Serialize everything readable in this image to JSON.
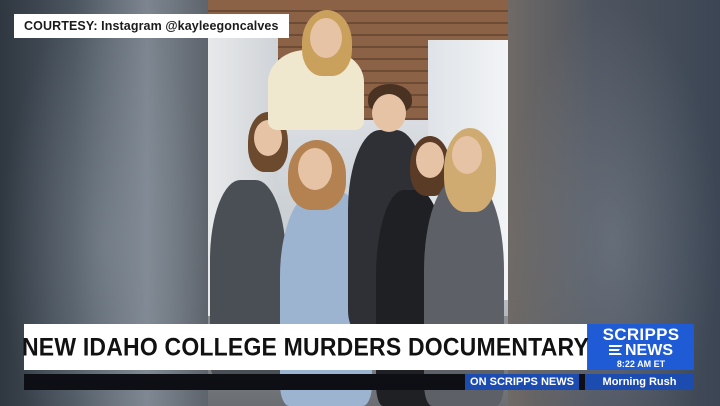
{
  "courtesy": {
    "text": "COURTESY: Instagram @kayleegoncalves"
  },
  "lower_third": {
    "headline": "NEW IDAHO COLLEGE MURDERS DOCUMENTARY",
    "logo_line1": "SCRIPPS",
    "logo_line2": "NEWS",
    "time": "8:22 AM ET",
    "ticker_source": "ON SCRIPPS NEWS",
    "show_name": "Morning Rush"
  },
  "colors": {
    "brand_blue": "#1e5bd4",
    "ticker_blue": "#1d4cb0",
    "ticker_dark": "#0d0f14"
  }
}
